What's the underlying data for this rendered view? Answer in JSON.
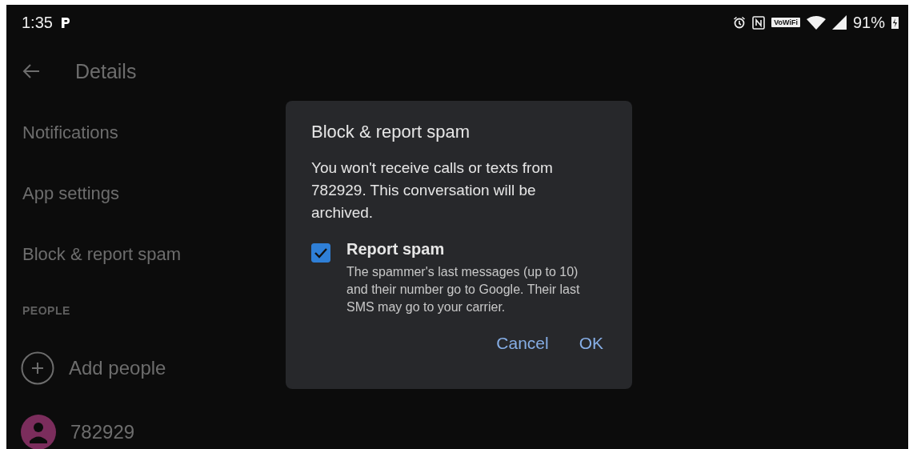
{
  "status_bar": {
    "time": "1:35",
    "wifi_calling": "VoWiFi",
    "battery": "91%"
  },
  "header": {
    "title": "Details"
  },
  "menu": [
    {
      "label": "Notifications"
    },
    {
      "label": "App settings"
    },
    {
      "label": "Block & report spam"
    }
  ],
  "people": {
    "heading": "PEOPLE",
    "items": [
      {
        "kind": "add",
        "label": "Add people"
      },
      {
        "kind": "contact",
        "label": "782929",
        "color": "#7b2d5c"
      }
    ]
  },
  "dialog": {
    "title": "Block & report spam",
    "message": "You won't receive calls or texts from 782929. This conversation will be archived.",
    "option": {
      "label": "Report spam",
      "checked": true,
      "description": "The spammer's last messages (up to 10) and their number go to Google. Their last SMS may go to your carrier."
    },
    "buttons": [
      "Cancel",
      "OK"
    ]
  }
}
